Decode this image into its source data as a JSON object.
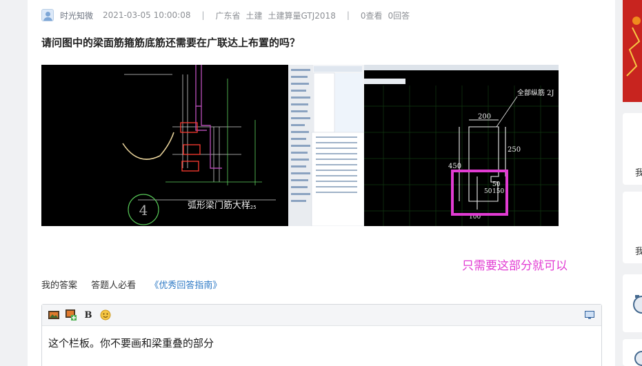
{
  "question": {
    "author": "时光知微",
    "datetime": "2021-03-05 10:00:08",
    "region": "广东省",
    "category": "土建",
    "software": "土建算量GTJ2018",
    "views": "0查看",
    "answers": "0回答",
    "title": "请问图中的梁面筋箍筋底筋还需要在广联达上布置的吗？"
  },
  "attached_image": {
    "cad_title": "弧形梁门筋大样",
    "cad_scale": "1:25",
    "section_label": "全部纵筋 2J",
    "dim_200": "200",
    "dim_250": "250",
    "dim_450": "450",
    "dim_50": "50",
    "dim_150": "150",
    "dim_50b": "50",
    "dim_100": "100",
    "circle_num": "4",
    "highlight_color": "#e23cd3"
  },
  "annotation": "只需要这部分就可以",
  "answer_section": {
    "my_answer": "我的答案",
    "must_read": "答题人必看",
    "guide_link": "《优秀回答指南》"
  },
  "editor": {
    "bold_label": "B",
    "content": "这个栏板。你不要画和梁重叠的部分"
  },
  "sidebar": {
    "card_text_1": "我",
    "card_text_2": "我"
  }
}
